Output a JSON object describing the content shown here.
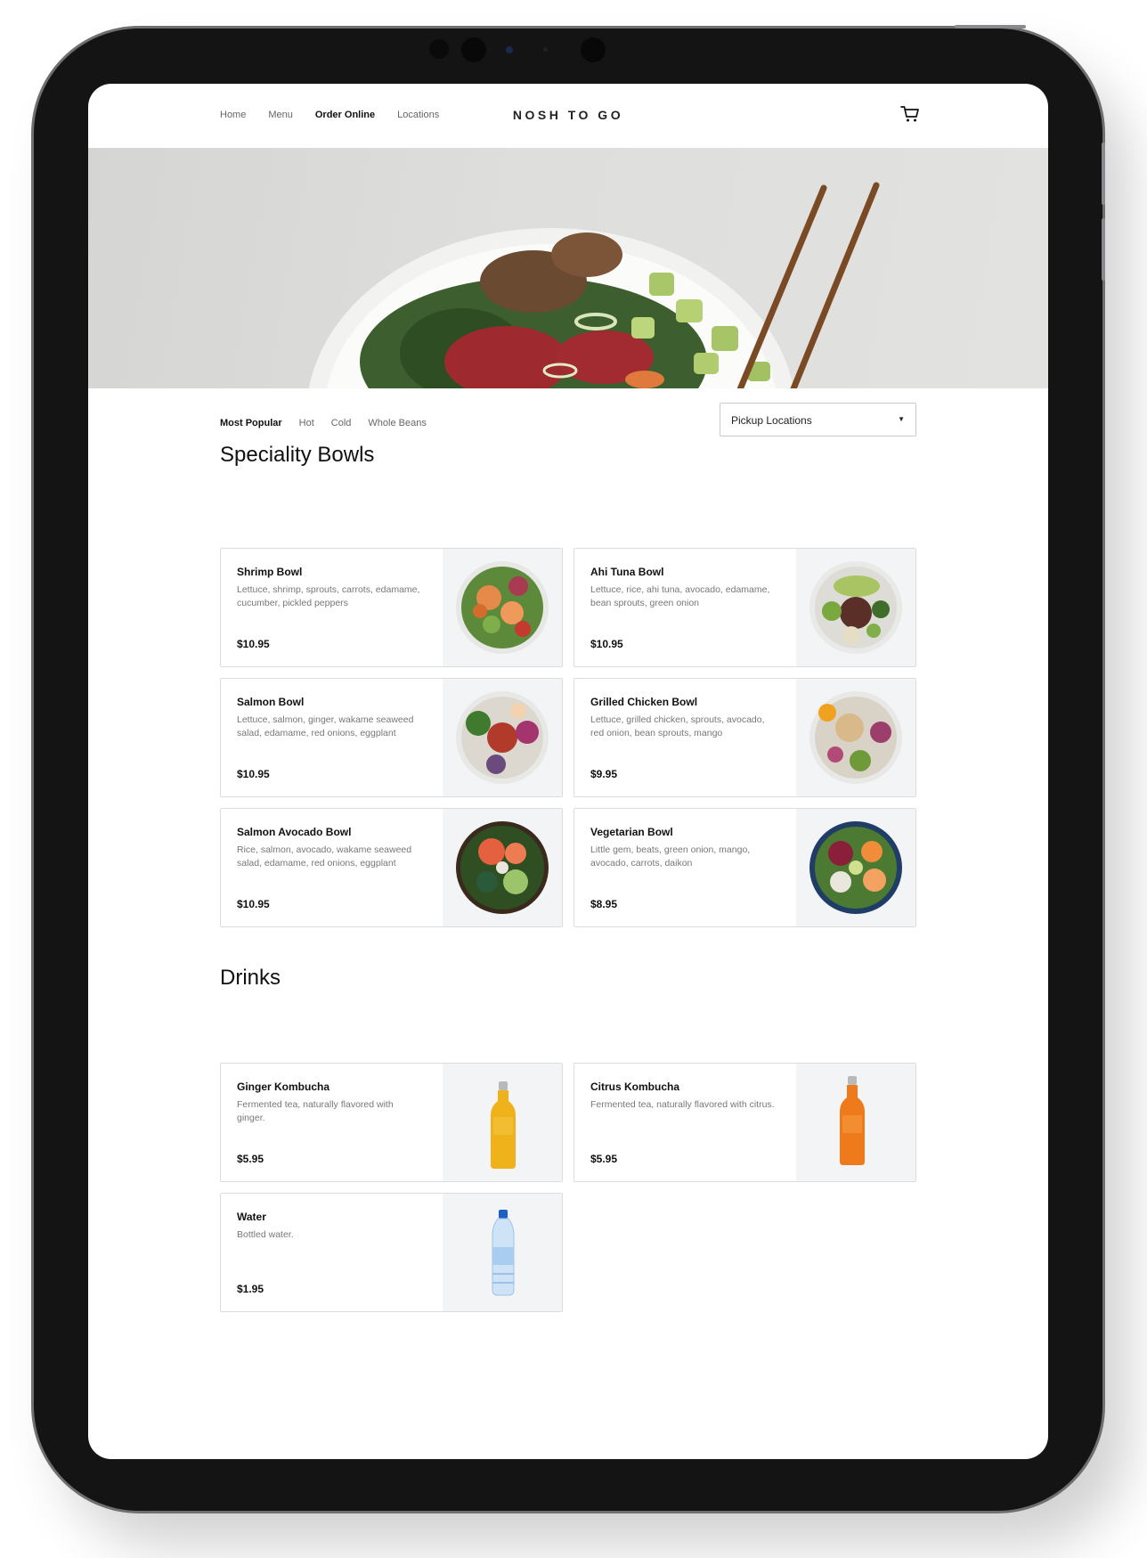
{
  "nav": {
    "links": [
      "Home",
      "Menu",
      "Order Online",
      "Locations"
    ],
    "brand": "NOSH TO GO",
    "cart_icon": "cart-icon"
  },
  "filters": {
    "tabs": [
      "Most Popular",
      "Hot",
      "Cold",
      "Whole Beans"
    ],
    "active": "Most Popular",
    "pickup_select": "Pickup Locations"
  },
  "bowls": {
    "title": "Speciality Bowls",
    "items": [
      {
        "name": "Shrimp Bowl",
        "desc": "Lettuce, shrimp, sprouts, carrots, edamame, cucumber, pickled peppers",
        "price": "$10.95"
      },
      {
        "name": "Ahi Tuna Bowl",
        "desc": "Lettuce, rice, ahi tuna, avocado, edamame, bean sprouts, green onion",
        "price": "$10.95"
      },
      {
        "name": "Salmon Bowl",
        "desc": "Lettuce, salmon, ginger, wakame seaweed salad, edamame, red onions, eggplant",
        "price": "$10.95"
      },
      {
        "name": "Grilled Chicken Bowl",
        "desc": "Lettuce, grilled chicken, sprouts, avocado, red onion, bean sprouts, mango",
        "price": "$9.95"
      },
      {
        "name": "Salmon Avocado Bowl",
        "desc": "Rice, salmon, avocado, wakame seaweed salad, edamame, red onions, eggplant",
        "price": "$10.95"
      },
      {
        "name": "Vegetarian Bowl",
        "desc": "Little gem, beats, green onion, mango, avocado, carrots, daikon",
        "price": "$8.95"
      }
    ]
  },
  "drinks": {
    "title": "Drinks",
    "items": [
      {
        "name": "Ginger Kombucha",
        "desc": "Fermented tea, naturally flavored with ginger.",
        "price": "$5.95"
      },
      {
        "name": "Citrus Kombucha",
        "desc": "Fermented tea, naturally flavored with citrus.",
        "price": "$5.95"
      },
      {
        "name": "Water",
        "desc": "Bottled water.",
        "price": "$1.95"
      }
    ]
  }
}
